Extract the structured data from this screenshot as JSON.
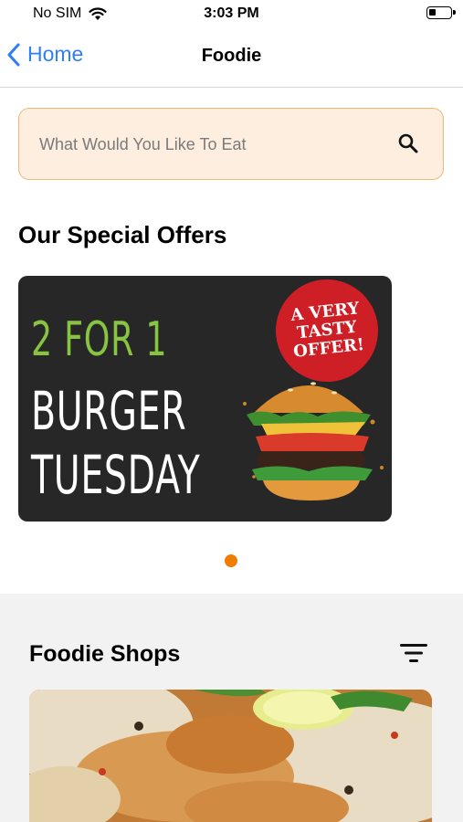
{
  "status_bar": {
    "carrier": "No SIM",
    "time": "3:03 PM"
  },
  "nav": {
    "back_label": "Home",
    "title": "Foodie"
  },
  "search": {
    "placeholder": "What Would You Like To Eat"
  },
  "offers": {
    "title": "Our Special Offers",
    "banner": {
      "line1": "2 FOR 1",
      "line2": "BURGER",
      "line3": "TUESDAY",
      "badge_lines": [
        "A VERY",
        "TASTY",
        "OFFER!"
      ]
    },
    "page_count": 1,
    "active_page": 1
  },
  "shops": {
    "title": "Foodie Shops"
  },
  "colors": {
    "accent": "#f07c00",
    "link": "#2f7ef6",
    "search_bg": "#fdeee0",
    "search_border": "#f0b67a",
    "banner_bg": "#272727",
    "banner_green": "#87c442",
    "badge_red": "#cf1f26"
  },
  "icons": [
    "wifi-icon",
    "battery-icon",
    "chevron-left-icon",
    "search-icon",
    "filter-icon"
  ]
}
